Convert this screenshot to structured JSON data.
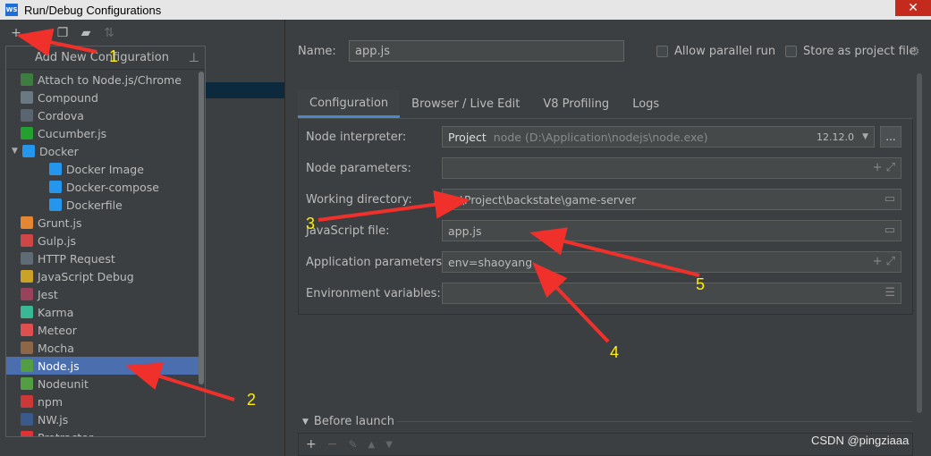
{
  "window": {
    "title": "Run/Debug Configurations",
    "app_icon": "WS",
    "close_glyph": "✕"
  },
  "left_toolbar": {
    "add": "+",
    "remove": "−",
    "copy": "❐",
    "folder": "▰",
    "sort": "⇅"
  },
  "popup": {
    "title": "Add New Configuration",
    "pin_glyph": "⊥",
    "items": [
      {
        "label": "Attach to Node.js/Chrome",
        "icon": "attach-node-icon",
        "color": "#3d7d3f",
        "indent": 0
      },
      {
        "label": "Compound",
        "icon": "compound-icon",
        "color": "#6b7a82",
        "indent": 0
      },
      {
        "label": "Cordova",
        "icon": "cordova-icon",
        "color": "#5a6570",
        "indent": 0
      },
      {
        "label": "Cucumber.js",
        "icon": "cucumber-icon",
        "color": "#23a02f",
        "indent": 0
      },
      {
        "label": "Docker",
        "icon": "docker-icon",
        "color": "#2496ed",
        "indent": 0,
        "expanded": true
      },
      {
        "label": "Docker Image",
        "icon": "docker-image-icon",
        "color": "#2496ed",
        "indent": 1
      },
      {
        "label": "Docker-compose",
        "icon": "docker-compose-icon",
        "color": "#2496ed",
        "indent": 1
      },
      {
        "label": "Dockerfile",
        "icon": "dockerfile-icon",
        "color": "#2496ed",
        "indent": 1
      },
      {
        "label": "Grunt.js",
        "icon": "grunt-icon",
        "color": "#e48632",
        "indent": 0
      },
      {
        "label": "Gulp.js",
        "icon": "gulp-icon",
        "color": "#cf4647",
        "indent": 0
      },
      {
        "label": "HTTP Request",
        "icon": "http-request-icon",
        "color": "#5f6b75",
        "indent": 0
      },
      {
        "label": "JavaScript Debug",
        "icon": "js-debug-icon",
        "color": "#c9a227",
        "indent": 0
      },
      {
        "label": "Jest",
        "icon": "jest-icon",
        "color": "#99425b",
        "indent": 0
      },
      {
        "label": "Karma",
        "icon": "karma-icon",
        "color": "#3ab795",
        "indent": 0
      },
      {
        "label": "Meteor",
        "icon": "meteor-icon",
        "color": "#de4f4f",
        "indent": 0
      },
      {
        "label": "Mocha",
        "icon": "mocha-icon",
        "color": "#8d6748",
        "indent": 0
      },
      {
        "label": "Node.js",
        "icon": "nodejs-icon",
        "color": "#539e43",
        "indent": 0,
        "selected": true
      },
      {
        "label": "Nodeunit",
        "icon": "nodeunit-icon",
        "color": "#539e43",
        "indent": 0
      },
      {
        "label": "npm",
        "icon": "npm-icon",
        "color": "#cb3837",
        "indent": 0
      },
      {
        "label": "NW.js",
        "icon": "nwjs-icon",
        "color": "#3a5a8c",
        "indent": 0
      },
      {
        "label": "Protractor",
        "icon": "protractor-icon",
        "color": "#e23237",
        "indent": 0
      }
    ]
  },
  "form": {
    "name_label": "Name:",
    "name_value": "app.js",
    "allow_parallel": "Allow parallel run",
    "store_project": "Store as project file",
    "tabs": [
      {
        "label": "Configuration",
        "active": true
      },
      {
        "label": "Browser / Live Edit",
        "active": false
      },
      {
        "label": "V8 Profiling",
        "active": false
      },
      {
        "label": "Logs",
        "active": false
      }
    ],
    "node_interpreter_label": "Node interpreter:",
    "interpreter_kind": "Project",
    "interpreter_path": "node (D:\\Application\\nodejs\\node.exe)",
    "interpreter_version": "12.12.0",
    "dots": "...",
    "node_params_label": "Node parameters:",
    "node_params_value": "",
    "working_dir_label": "Working directory:",
    "working_dir_value": "D:\\Project\\backstate\\game-server",
    "js_file_label": "JavaScript file:",
    "js_file_value": "app.js",
    "app_params_label": "Application parameters:",
    "app_params_value": "env=shaoyang",
    "env_vars_label": "Environment variables:",
    "env_vars_value": "",
    "before_launch": "Before launch"
  },
  "annotations": {
    "arrow_color": "#f0302a",
    "label_color": "#ffee00",
    "labels": [
      "1",
      "2",
      "3",
      "4",
      "5"
    ]
  },
  "watermark": "CSDN @pingziaaa"
}
